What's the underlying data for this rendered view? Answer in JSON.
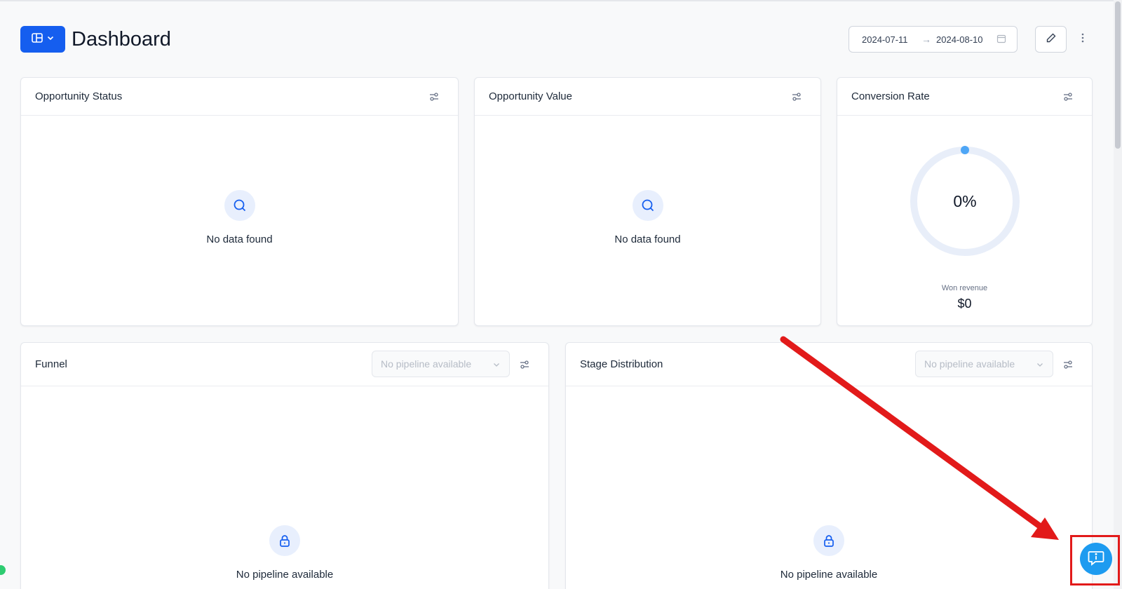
{
  "header": {
    "title": "Dashboard",
    "date_start": "2024-07-11",
    "date_arrow": "→",
    "date_end": "2024-08-10"
  },
  "cards": {
    "opportunity_status": {
      "title": "Opportunity Status",
      "empty_text": "No data found"
    },
    "opportunity_value": {
      "title": "Opportunity Value",
      "empty_text": "No data found"
    },
    "conversion_rate": {
      "title": "Conversion Rate",
      "rate_text": "0%",
      "rate_fraction": 0,
      "won_revenue_label": "Won revenue",
      "won_revenue_value": "$0"
    },
    "funnel": {
      "title": "Funnel",
      "pipeline_select": "No pipeline available",
      "empty_text": "No pipeline available"
    },
    "stage_distribution": {
      "title": "Stage Distribution",
      "pipeline_select": "No pipeline available",
      "empty_text": "No pipeline available"
    }
  },
  "colors": {
    "primary": "#155eef",
    "gauge_track": "#e8eef9",
    "gauge_marker": "#4ea6f6",
    "annotation": "#e21a1a",
    "chat_button": "#1d9bf0",
    "status_dot": "#2ecc71"
  },
  "icons": {
    "layout": "layout-columns-icon",
    "filter": "sliders-icon",
    "empty_search": "search-icon",
    "empty_lock": "lock-icon",
    "calendar": "calendar-icon",
    "edit": "pencil-icon",
    "more": "more-vertical-icon",
    "chat": "chat-info-icon"
  }
}
